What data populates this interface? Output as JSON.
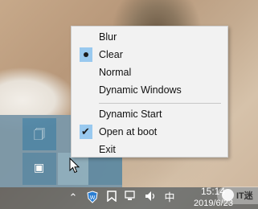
{
  "menu": {
    "items": [
      {
        "label": "Blur",
        "state": ""
      },
      {
        "label": "Clear",
        "state": "radio"
      },
      {
        "label": "Normal",
        "state": ""
      },
      {
        "label": "Dynamic Windows",
        "state": ""
      },
      {
        "label": "Dynamic Start",
        "state": ""
      },
      {
        "label": "Open at boot",
        "state": "checked"
      },
      {
        "label": "Exit",
        "state": ""
      }
    ],
    "selected_color": "#99c9ef"
  },
  "taskbar": {
    "tray_icons": [
      "chevron-up-icon",
      "shield-app-icon",
      "bookmark-flag-icon",
      "network-icon",
      "volume-icon",
      "ime-icon"
    ],
    "ime_label": "中",
    "time": "15:14",
    "date": "2019/6/23"
  },
  "watermark": {
    "text": "IT迷"
  }
}
